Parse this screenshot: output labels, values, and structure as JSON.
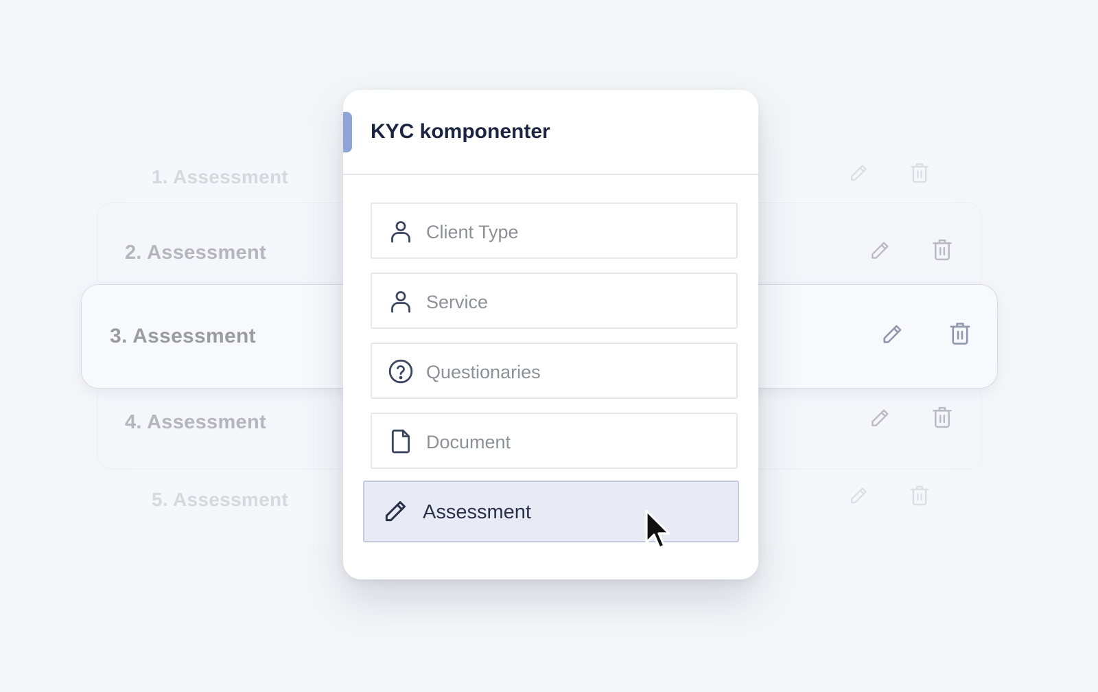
{
  "background_rows": [
    {
      "label": "1. Assessment"
    },
    {
      "label": "2. Assessment"
    },
    {
      "label": "3. Assessment"
    },
    {
      "label": "4. Assessment"
    },
    {
      "label": "5. Assessment"
    }
  ],
  "panel": {
    "title": "KYC komponenter",
    "items": [
      {
        "label": "Client Type",
        "icon": "user-icon"
      },
      {
        "label": "Service",
        "icon": "user-icon"
      },
      {
        "label": "Questionaries",
        "icon": "question-circle-icon"
      },
      {
        "label": "Document",
        "icon": "document-icon"
      },
      {
        "label": "Assessment",
        "icon": "pencil-icon",
        "active": true
      }
    ]
  },
  "colors": {
    "accent": "#8fa3d4",
    "title": "#1b2440",
    "active_bg": "#e8ebf5",
    "active_border": "#c4cbe0"
  }
}
